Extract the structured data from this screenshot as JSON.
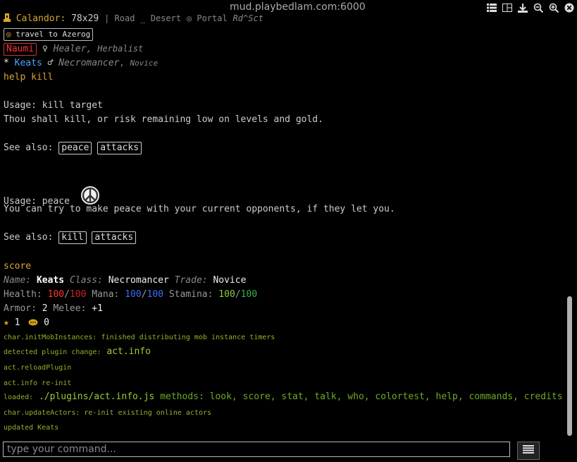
{
  "titlebar": {
    "host": "mud.playbedlam.com:6000"
  },
  "status": {
    "location": "Calandor",
    "coords": "78x29",
    "tags": [
      "Road",
      "Desert",
      "Portal"
    ],
    "extra": "Rd^Sct",
    "travel": "travel to Azerog"
  },
  "party": [
    {
      "name": "Naumi",
      "gender": "♀",
      "class": "Healer",
      "trade": "Herbalist"
    },
    {
      "prefix": "*",
      "name": "Keats",
      "gender": "♂",
      "class": "Necromancer",
      "trade": "Novice"
    }
  ],
  "help_kill": {
    "command": "help kill",
    "usage_label": "Usage:",
    "usage": "kill target",
    "description": "Thou shall kill, or risk remaining low on levels and gold.",
    "see_also_label": "See also:",
    "see_also": [
      "peace",
      "attacks"
    ]
  },
  "help_peace": {
    "usage_label": "Usage:",
    "usage": "peace",
    "description": "You can try to make peace with your current opponents, if they let you.",
    "see_also_label": "See also:",
    "see_also": [
      "kill",
      "attacks"
    ]
  },
  "score": {
    "command": "score",
    "name_label": "Name:",
    "name": "Keats",
    "class_label": "Class:",
    "class": "Necromancer",
    "trade_label": "Trade:",
    "trade": "Novice",
    "health_label": "Health:",
    "health": "100",
    "health_max": "100",
    "mana_label": "Mana:",
    "mana": "100",
    "mana_max": "100",
    "stamina_label": "Stamina:",
    "stamina": "100",
    "stamina_max": "100",
    "armor_label": "Armor:",
    "armor": "2",
    "melee_label": "Melee:",
    "melee": "+1",
    "stars": "1",
    "gold": "0"
  },
  "log": {
    "l1": "char.initMobInstances: finished distributing mob instance timers",
    "l2_a": "detected plugin change:",
    "l2_b": "act.info",
    "l3": "act.reloadPlugin",
    "l4": "act.info re-init",
    "l5_a": "loaded:",
    "l5_b": "./plugins/act.info.js",
    "l5_c": "methods: look, score, stat, talk, who, colortest, help, commands, credits",
    "l6": "char.updateActors: re-init existing online actors",
    "l7": "updated Keats"
  },
  "input": {
    "placeholder": "type your command..."
  },
  "colors": {
    "accent": "#d7a72f",
    "log_green": "#8fb32b",
    "health": "#ff3333",
    "mana": "#3b6cf5",
    "stamina": "#37b24d"
  }
}
